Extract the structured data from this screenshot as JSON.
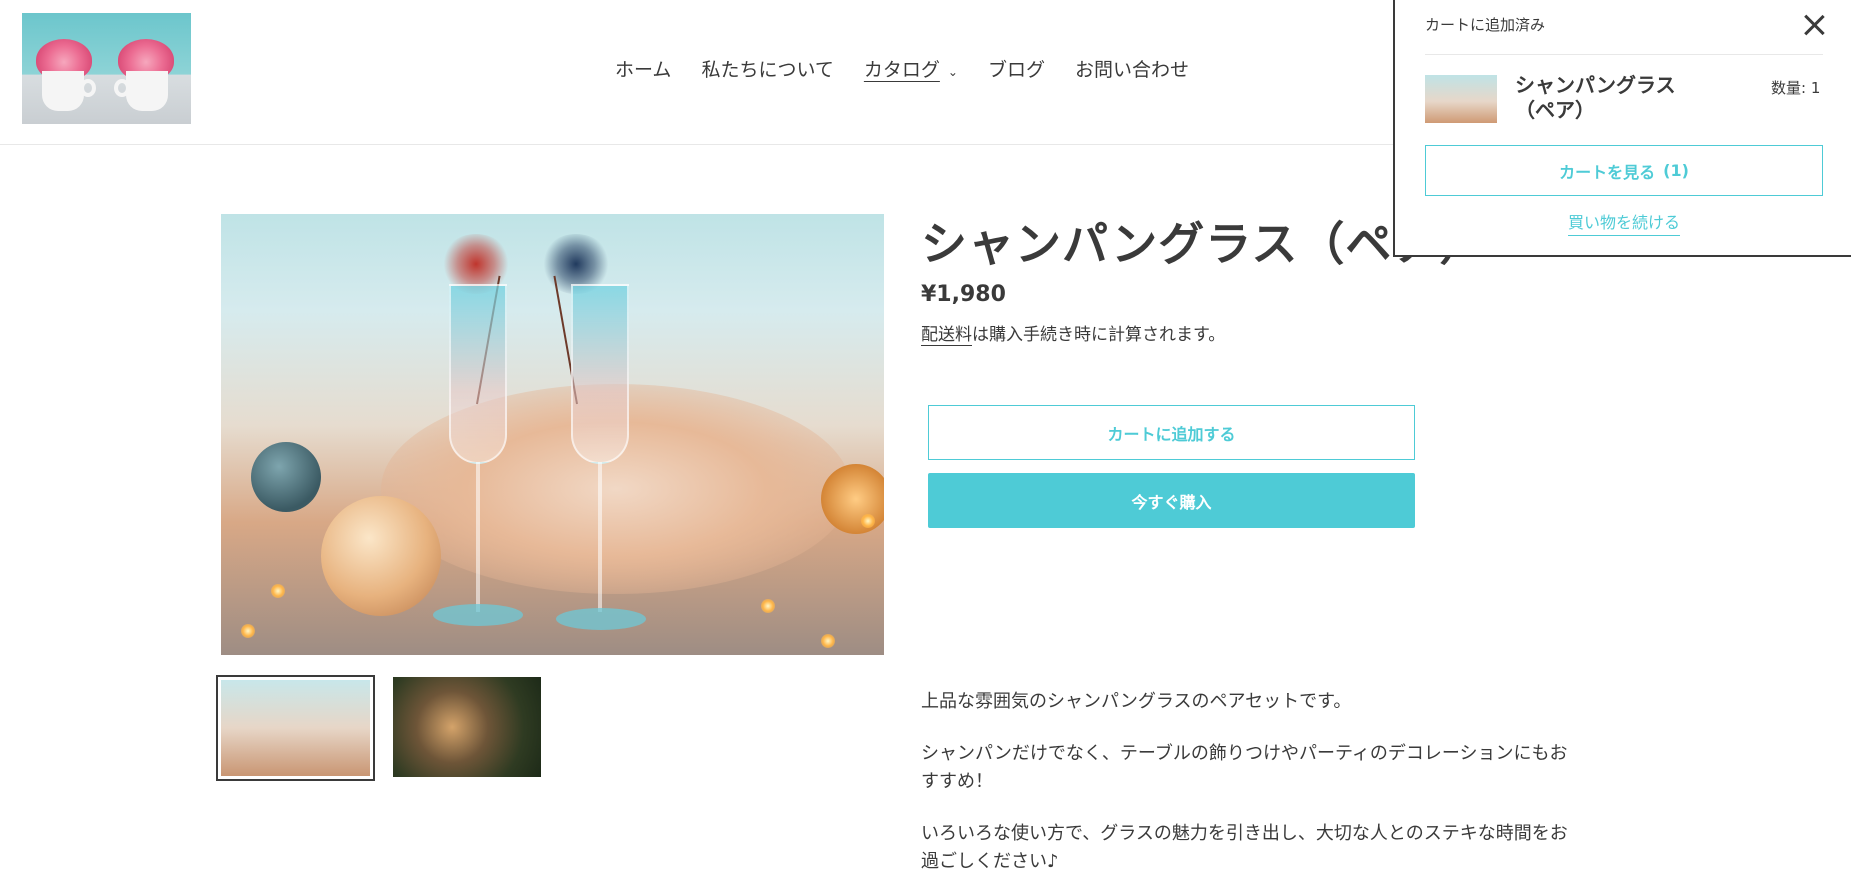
{
  "header": {
    "logo_alt": "pink flowers in white cups",
    "nav": [
      {
        "label": "ホーム"
      },
      {
        "label": "私たちについて"
      },
      {
        "label": "カタログ"
      },
      {
        "label": "ブログ"
      },
      {
        "label": "お問い合わせ"
      }
    ]
  },
  "product": {
    "title": "シャンパングラス（ペア）",
    "price": "¥1,980",
    "shipping_link": "配送料",
    "shipping_rest": "は購入手続き時に計算されます。",
    "add_to_cart": "カートに追加する",
    "buy_now": "今すぐ購入",
    "description": [
      "上品な雰囲気のシャンパングラスのペアセットです。",
      "シャンパンだけでなく、テーブルの飾りつけやパーティのデコレーションにもおすすめ！",
      "いろいろな使い方で、グラスの魅力を引き出し、大切な人とのステキな時間をお過ごしください♪"
    ]
  },
  "cart_popup": {
    "heading": "カートに追加済み",
    "item_name": "シャンパングラス（ペア）",
    "quantity": "数量: 1",
    "view_cart": "カートを見る",
    "view_cart_count": "(1)",
    "continue_shopping": "買い物を続ける"
  },
  "colors": {
    "accent": "#4ecbd6",
    "text": "#3a3a3a"
  }
}
